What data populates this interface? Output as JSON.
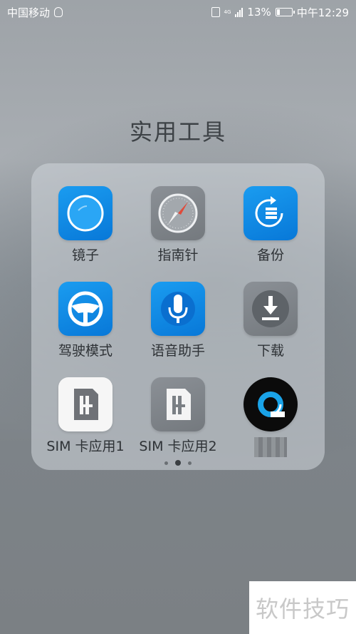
{
  "status": {
    "carrier": "中国移动",
    "network": "4G",
    "battery": "13%",
    "time": "中午12:29"
  },
  "folder": {
    "title": "实用工具",
    "pages": 3,
    "active_page": 2,
    "apps": [
      {
        "label": "镜子",
        "icon": "mirror-icon"
      },
      {
        "label": "指南针",
        "icon": "compass-icon"
      },
      {
        "label": "备份",
        "icon": "backup-icon"
      },
      {
        "label": "驾驶模式",
        "icon": "steering-wheel-icon"
      },
      {
        "label": "语音助手",
        "icon": "microphone-icon"
      },
      {
        "label": "下载",
        "icon": "download-icon"
      },
      {
        "label": "SIM 卡应用1",
        "icon": "sim-card-icon"
      },
      {
        "label": "SIM 卡应用2",
        "icon": "sim-card-icon"
      },
      {
        "label": "",
        "icon": "quik-app-icon"
      }
    ]
  },
  "watermark": "软件技巧"
}
